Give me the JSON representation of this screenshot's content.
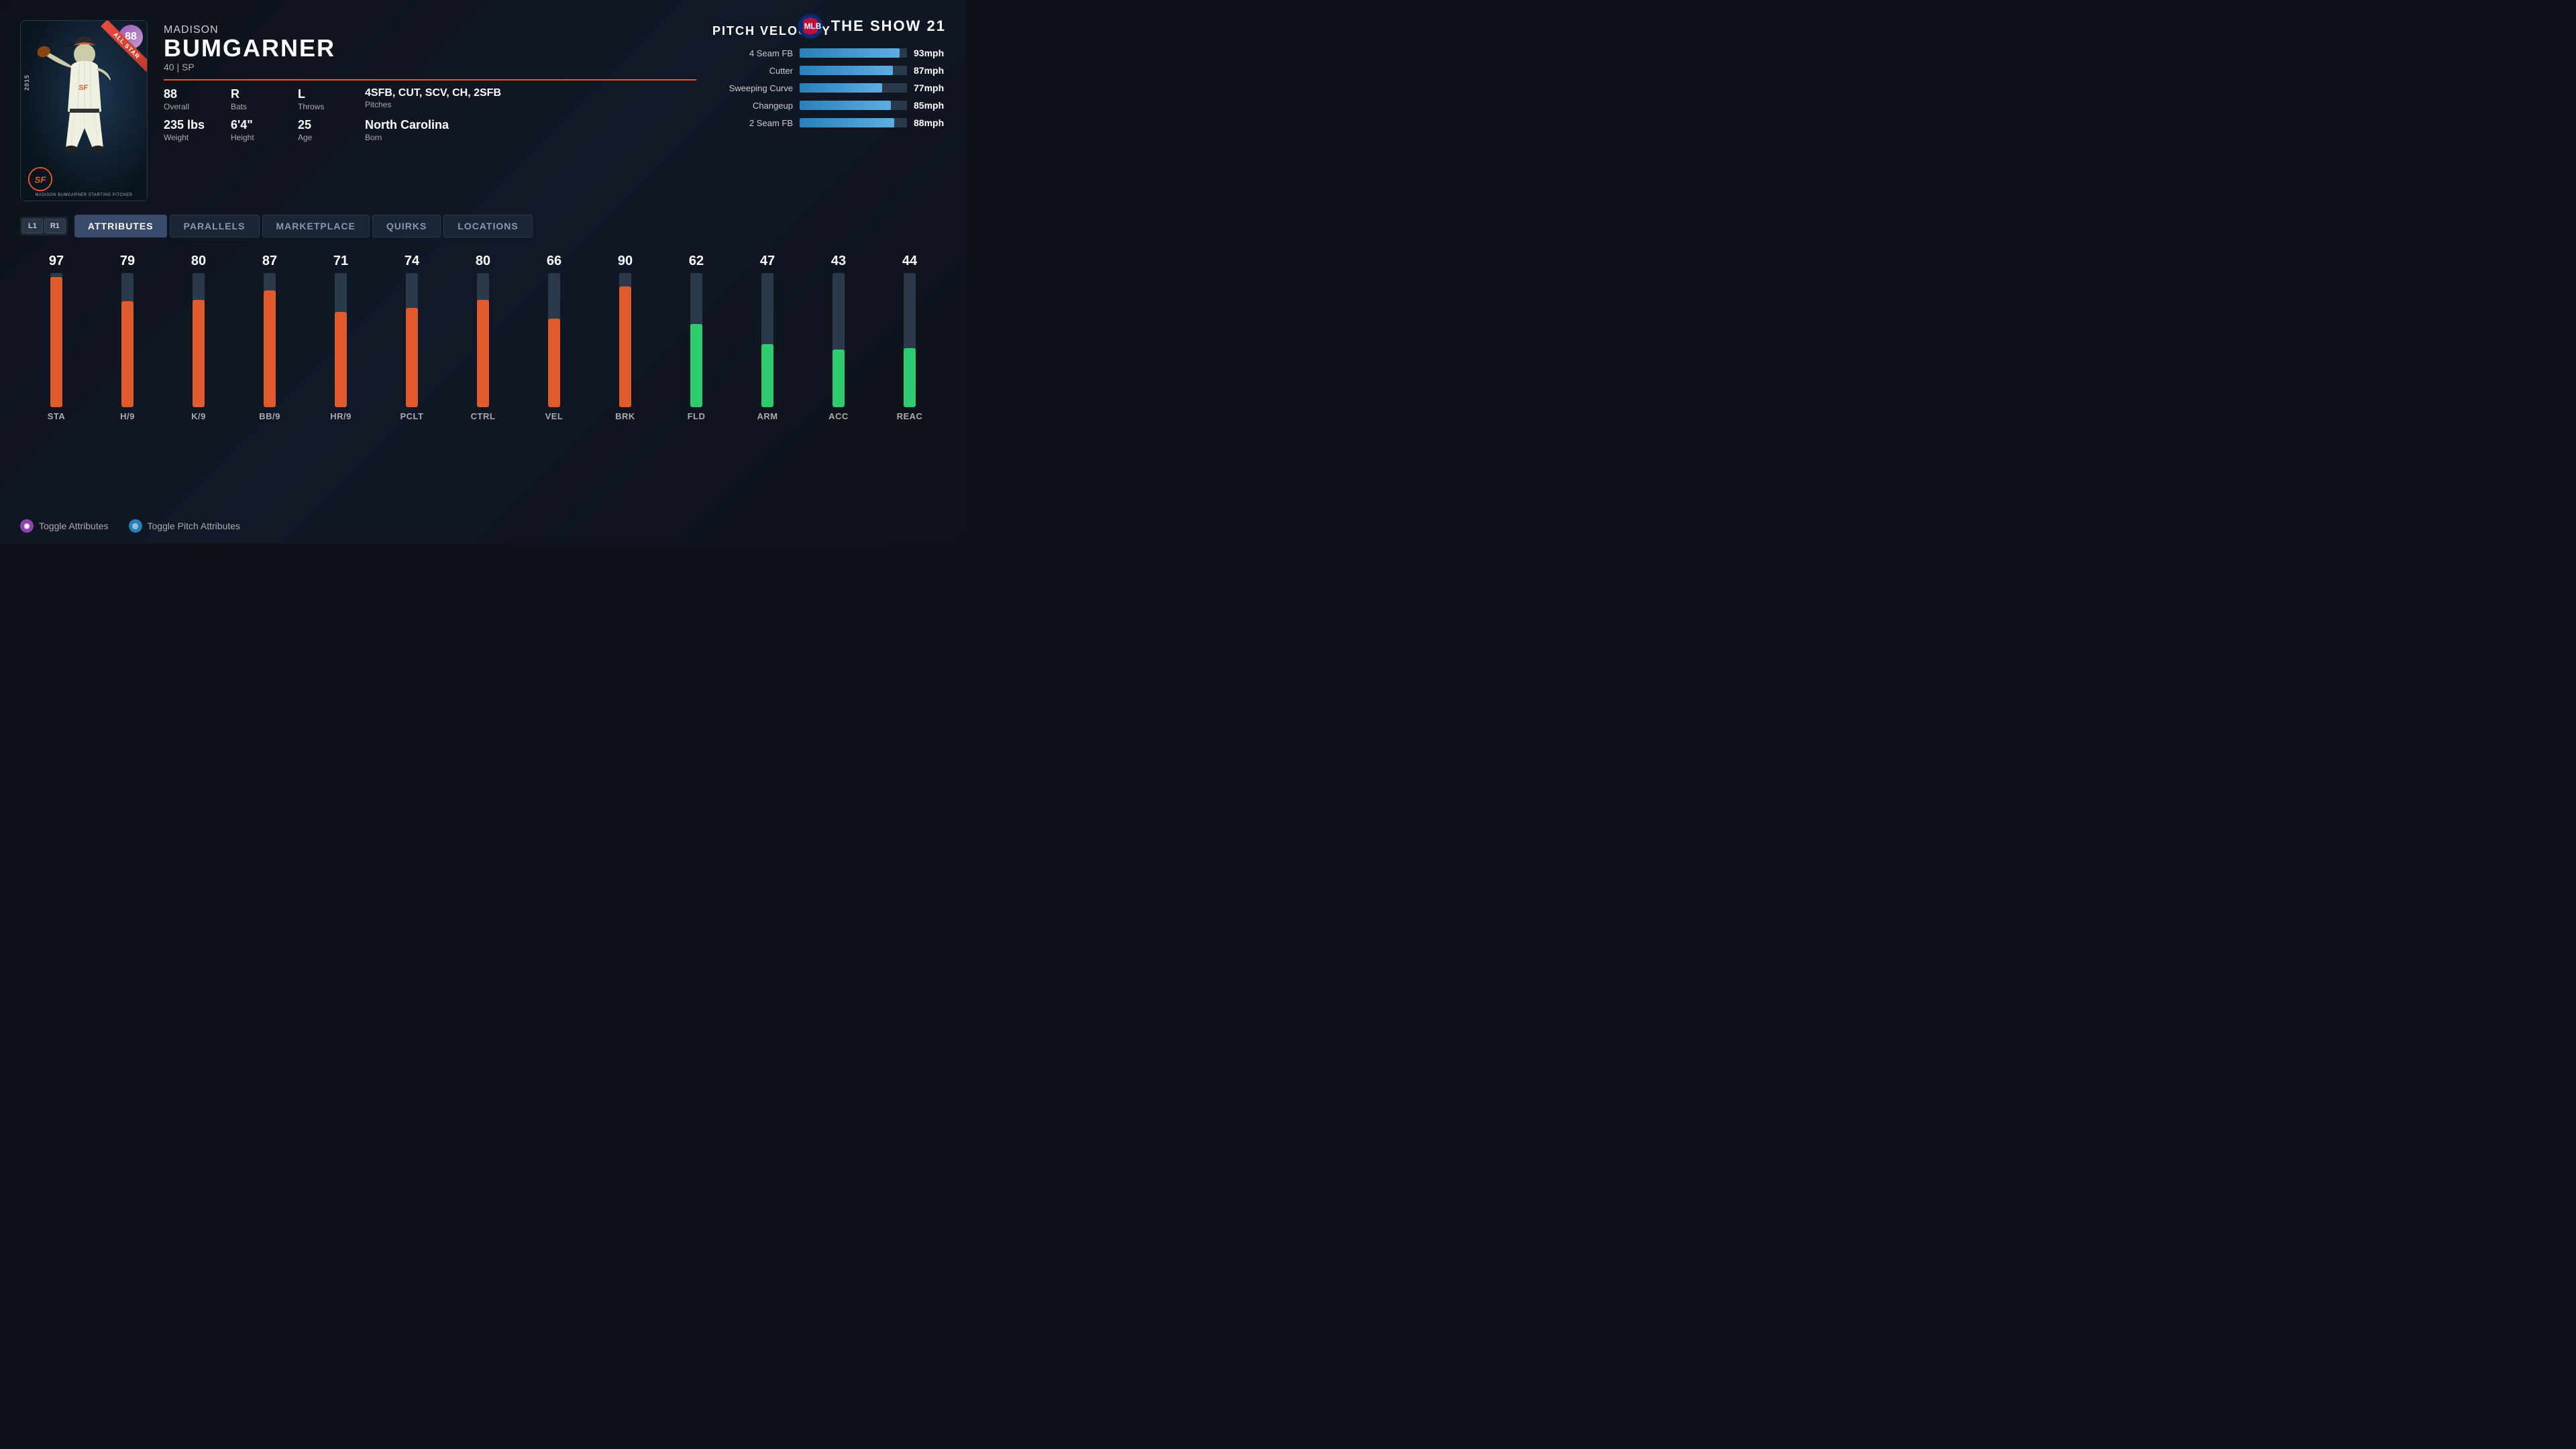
{
  "logo": {
    "game_title": "THE SHOW 21"
  },
  "player": {
    "first_name": "MADISON",
    "last_name": "BUMGARNER",
    "age_position": "40 | SP",
    "card_rating": "88",
    "card_year": "2015",
    "card_type": "ALL STAR",
    "overall_label": "Overall",
    "overall_value": "88",
    "bats_label": "Bats",
    "bats_value": "R",
    "throws_label": "Throws",
    "throws_value": "L",
    "pitches_label": "Pitches",
    "pitches_value": "4SFB, CUT, SCV, CH, 2SFB",
    "weight_label": "Weight",
    "weight_value": "235 lbs",
    "height_label": "Height",
    "height_value": "6'4\"",
    "age_label": "Age",
    "age_value": "25",
    "born_label": "Born",
    "born_value": "North Carolina",
    "team": "SF Giants",
    "card_bottom_text": "MADISON BUMGARNER  STARTING PITCHER"
  },
  "pitch_velocity": {
    "title": "PITCH VELOCITY",
    "pitches": [
      {
        "name": "4 Seam FB",
        "speed": "93mph",
        "value": 93,
        "max": 100
      },
      {
        "name": "Cutter",
        "speed": "87mph",
        "value": 87,
        "max": 100
      },
      {
        "name": "Sweeping Curve",
        "speed": "77mph",
        "value": 77,
        "max": 100
      },
      {
        "name": "Changeup",
        "speed": "85mph",
        "value": 85,
        "max": 100
      },
      {
        "name": "2 Seam FB",
        "speed": "88mph",
        "value": 88,
        "max": 100
      }
    ]
  },
  "tabs": {
    "controller_l1": "L1",
    "controller_r1": "R1",
    "items": [
      {
        "label": "ATTRIBUTES",
        "active": true
      },
      {
        "label": "PARALLELS",
        "active": false
      },
      {
        "label": "MARKETPLACE",
        "active": false
      },
      {
        "label": "QUIRKS",
        "active": false
      },
      {
        "label": "LOCATIONS",
        "active": false
      }
    ]
  },
  "attributes": [
    {
      "name": "STA",
      "value": 97,
      "bar_type": "orange"
    },
    {
      "name": "H/9",
      "value": 79,
      "bar_type": "orange"
    },
    {
      "name": "K/9",
      "value": 80,
      "bar_type": "orange"
    },
    {
      "name": "BB/9",
      "value": 87,
      "bar_type": "orange"
    },
    {
      "name": "HR/9",
      "value": 71,
      "bar_type": "orange"
    },
    {
      "name": "PCLT",
      "value": 74,
      "bar_type": "orange"
    },
    {
      "name": "CTRL",
      "value": 80,
      "bar_type": "orange"
    },
    {
      "name": "VEL",
      "value": 66,
      "bar_type": "orange"
    },
    {
      "name": "BRK",
      "value": 90,
      "bar_type": "orange"
    },
    {
      "name": "FLD",
      "value": 62,
      "bar_type": "teal"
    },
    {
      "name": "ARM",
      "value": 47,
      "bar_type": "teal"
    },
    {
      "name": "ACC",
      "value": 43,
      "bar_type": "teal"
    },
    {
      "name": "REAC",
      "value": 44,
      "bar_type": "teal"
    }
  ],
  "footer": {
    "toggle_attributes_label": "Toggle Attributes",
    "toggle_pitch_label": "Toggle Pitch Attributes",
    "icon1_symbol": "◉",
    "icon2_symbol": "◎"
  }
}
